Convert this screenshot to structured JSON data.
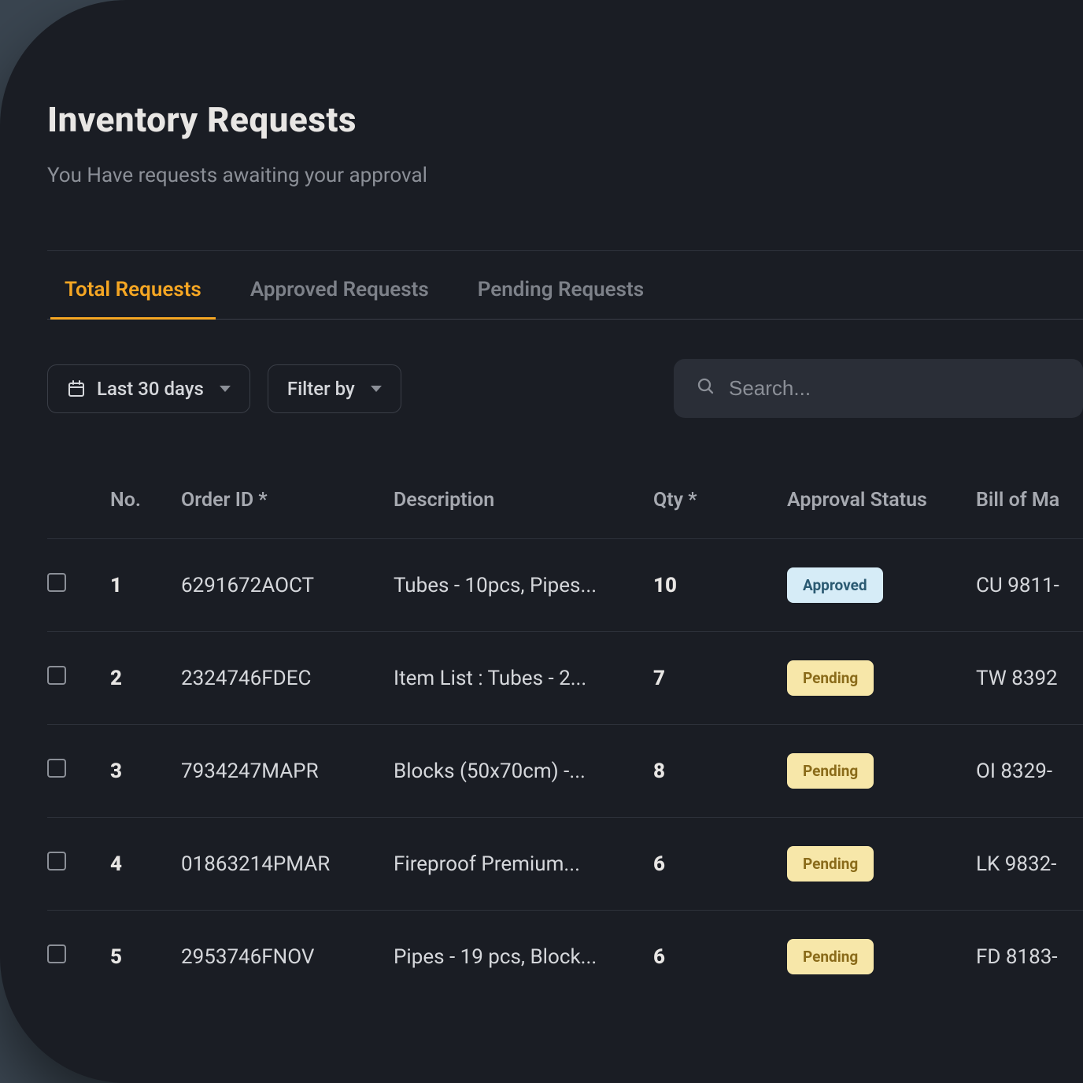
{
  "header": {
    "title": "Inventory Requests",
    "subtitle": "You Have requests awaiting your approval"
  },
  "tabs": [
    {
      "label": "Total Requests",
      "active": true
    },
    {
      "label": "Approved Requests",
      "active": false
    },
    {
      "label": "Pending Requests",
      "active": false
    }
  ],
  "controls": {
    "date_filter_label": "Last 30 days",
    "filter_label": "Filter by",
    "search_placeholder": "Search..."
  },
  "table": {
    "headers": {
      "no": "No.",
      "order_id": "Order ID *",
      "description": "Description",
      "qty": "Qty *",
      "status": "Approval Status",
      "bom": "Bill of Ma"
    },
    "rows": [
      {
        "no": "1",
        "order_id": "6291672AOCT",
        "description": "Tubes - 10pcs, Pipes...",
        "qty": "10",
        "status": "Approved",
        "status_class": "approved",
        "bom": "CU 9811-"
      },
      {
        "no": "2",
        "order_id": "2324746FDEC",
        "description": "Item List : Tubes - 2...",
        "qty": "7",
        "status": "Pending",
        "status_class": "pending",
        "bom": "TW 8392"
      },
      {
        "no": "3",
        "order_id": "7934247MAPR",
        "description": "Blocks (50x70cm) -...",
        "qty": "8",
        "status": "Pending",
        "status_class": "pending",
        "bom": "OI 8329-"
      },
      {
        "no": "4",
        "order_id": "01863214PMAR",
        "description": "Fireproof Premium...",
        "qty": "6",
        "status": "Pending",
        "status_class": "pending",
        "bom": "LK 9832-"
      },
      {
        "no": "5",
        "order_id": "2953746FNOV",
        "description": "Pipes - 19 pcs, Block...",
        "qty": "6",
        "status": "Pending",
        "status_class": "pending",
        "bom": "FD 8183-"
      }
    ]
  }
}
